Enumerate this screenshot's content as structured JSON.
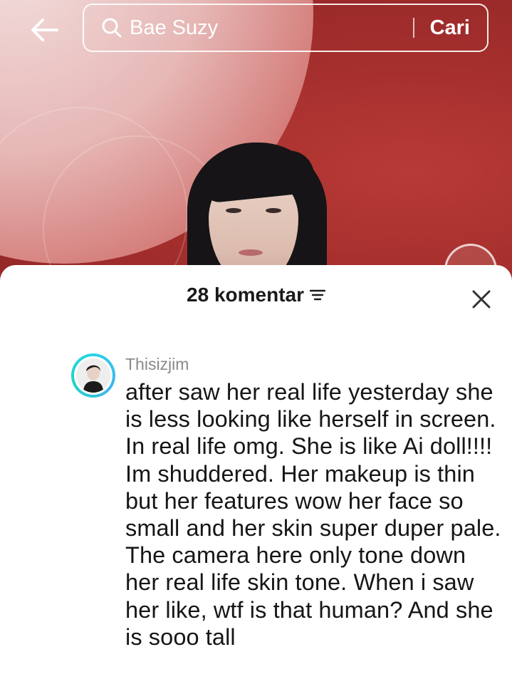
{
  "search": {
    "query": "Bae Suzy",
    "submit_label": "Cari"
  },
  "comments_panel": {
    "title": "28 komentar",
    "comments": [
      {
        "username": "Thisizjim",
        "text": "after saw her real life yesterday she is less looking like herself in screen. In real life omg. She is like Ai doll!!!! Im shuddered. Her makeup is thin but her features wow her face so small and her skin super duper pale. The camera here only tone down her real life skin tone. When i saw her like, wtf is that human? And she is sooo tall"
      }
    ]
  },
  "icons": {
    "back": "arrow-left-icon",
    "search": "search-icon",
    "sort": "sort-lines-icon",
    "close": "close-icon"
  },
  "colors": {
    "background_red": "#a52f2d",
    "avatar_ring": "#25d5e8",
    "username": "#8a8a8a",
    "text": "#161616"
  }
}
